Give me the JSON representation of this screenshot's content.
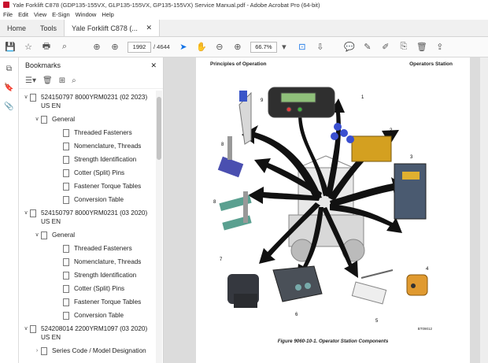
{
  "window": {
    "title": "Yale Forklift C878 (GDP135-155VX, GLP135-155VX, GP135-155VX) Service Manual.pdf - Adobe Acrobat Pro (64-bit)"
  },
  "menu": [
    "File",
    "Edit",
    "View",
    "E-Sign",
    "Window",
    "Help"
  ],
  "tabs": {
    "home": "Home",
    "tools": "Tools",
    "doc": "Yale Forklift C878 (..."
  },
  "toolbar": {
    "page_current": "1992",
    "page_total": "/ 4644",
    "zoom": "66.7%"
  },
  "bookmarks": {
    "title": "Bookmarks",
    "items": [
      {
        "level": 0,
        "expanded": true,
        "label": "524150797 8000YRM0231 (02 2023) US EN"
      },
      {
        "level": 1,
        "expanded": true,
        "label": "General"
      },
      {
        "level": 2,
        "label": "Threaded Fasteners"
      },
      {
        "level": 2,
        "label": "Nomenclature, Threads"
      },
      {
        "level": 2,
        "label": "Strength Identification"
      },
      {
        "level": 2,
        "label": "Cotter (Split) Pins"
      },
      {
        "level": 2,
        "label": "Fastener Torque Tables"
      },
      {
        "level": 2,
        "label": "Conversion Table"
      },
      {
        "level": 0,
        "expanded": true,
        "label": "524150797 8000YRM0231 (03 2020) US EN"
      },
      {
        "level": 1,
        "expanded": true,
        "label": "General"
      },
      {
        "level": 2,
        "label": "Threaded Fasteners"
      },
      {
        "level": 2,
        "label": "Nomenclature, Threads"
      },
      {
        "level": 2,
        "label": "Strength Identification"
      },
      {
        "level": 2,
        "label": "Cotter (Split) Pins"
      },
      {
        "level": 2,
        "label": "Fastener Torque Tables"
      },
      {
        "level": 2,
        "label": "Conversion Table"
      },
      {
        "level": 0,
        "expanded": true,
        "label": "524208014 2200YRM1097 (03 2020) US EN"
      },
      {
        "level": 1,
        "expanded": false,
        "label": "Series Code / Model Designation"
      }
    ]
  },
  "page": {
    "header_left": "Principles of Operation",
    "header_right": "Operators Station",
    "figure_code": "BT09012",
    "caption": "Figure 9060-10-1. Operator Station Components",
    "callouts": [
      "1",
      "2",
      "3",
      "4",
      "5",
      "6",
      "7",
      "8",
      "8",
      "9"
    ]
  },
  "colors": {
    "accent": "#1473e6",
    "brand": "#c8102e"
  }
}
